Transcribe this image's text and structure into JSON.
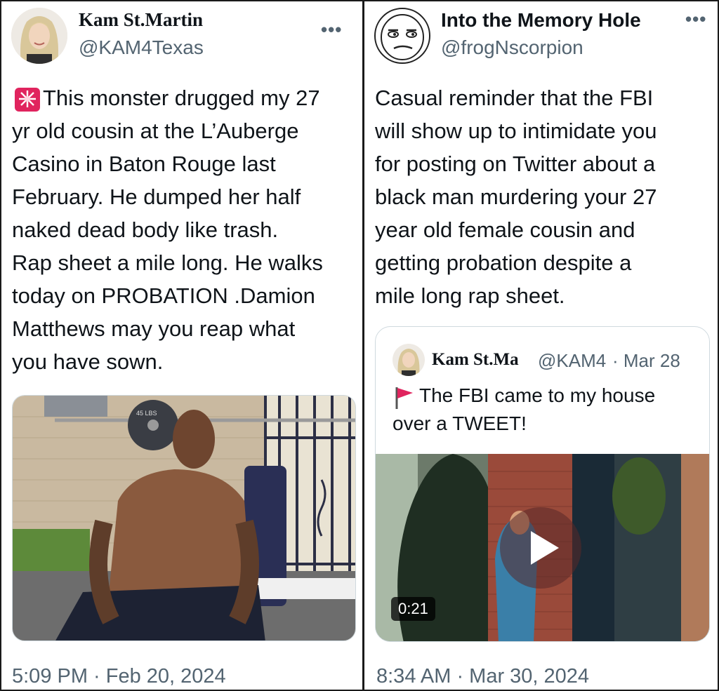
{
  "left_tweet": {
    "name": "Kam St.Martin",
    "handle": "@KAM4Texas",
    "more_label": "•••",
    "alert_icon": "police-light-icon",
    "body": "This monster drugged my 27\nyr old cousin at the L’Auberge\nCasino in Baton Rouge last\nFebruary. He dumped her half\nnaked dead body like trash.\nRap sheet a mile long. He walks\ntoday on PROBATION .Damion\nMatthews may you reap what\nyou have sown.",
    "timestamp": "5:09 PM · Feb 20, 2024",
    "photo_plate_text": "45 LBS"
  },
  "right_tweet": {
    "name": "Into the Memory Hole",
    "handle": "@frogNscorpion",
    "more_label": "•••",
    "body": "Casual reminder that the FBI\nwill show up to intimidate you\nfor posting on Twitter about a\nblack man murdering your 27\nyear old female cousin and\ngetting probation despite a\nmile long rap sheet.",
    "timestamp": "8:34 AM · Mar 30, 2024",
    "quoted": {
      "name": "Kam St.Ma",
      "handle": "@KAM4",
      "date": "· Mar 28",
      "flag_icon": "red-flag-icon",
      "text": "The FBI came to my house\nover a TWEET!",
      "video_duration": "0:21",
      "play_icon": "play-icon"
    }
  },
  "colors": {
    "text_primary": "#0f1419",
    "text_secondary": "#536471",
    "border": "#cfd9de",
    "alert_red": "#e0245e",
    "flag_red": "#e0245e"
  }
}
